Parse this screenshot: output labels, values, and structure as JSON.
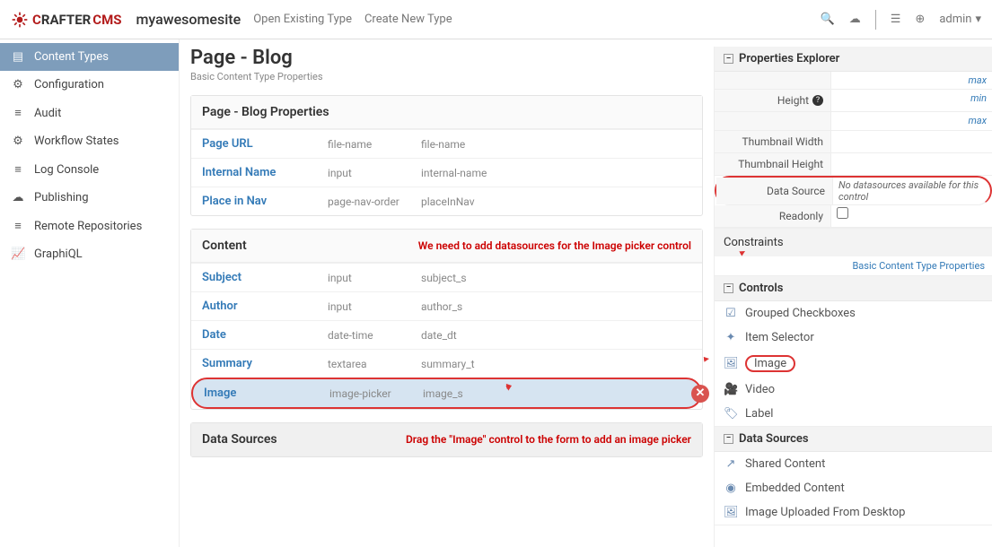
{
  "navbar": {
    "logo_text": "CRAFTER CMS",
    "site_name": "myawesomesite",
    "links": [
      "Open Existing Type",
      "Create New Type"
    ],
    "admin_label": "admin"
  },
  "sidebar": {
    "items": [
      {
        "icon": "list",
        "label": "Content Types"
      },
      {
        "icon": "gear",
        "label": "Configuration"
      },
      {
        "icon": "lines",
        "label": "Audit"
      },
      {
        "icon": "gear",
        "label": "Workflow States"
      },
      {
        "icon": "lines",
        "label": "Log Console"
      },
      {
        "icon": "cloud",
        "label": "Publishing"
      },
      {
        "icon": "lines",
        "label": "Remote Repositories"
      },
      {
        "icon": "chart",
        "label": "GraphiQL"
      }
    ]
  },
  "center": {
    "title": "Page - Blog",
    "subtitle": "Basic Content Type Properties",
    "panel1": {
      "heading": "Page - Blog Properties",
      "rows": [
        {
          "label": "Page URL",
          "control": "file-name",
          "var": "file-name"
        },
        {
          "label": "Internal Name",
          "control": "input",
          "var": "internal-name"
        },
        {
          "label": "Place in Nav",
          "control": "page-nav-order",
          "var": "placeInNav"
        }
      ]
    },
    "panel2": {
      "heading": "Content",
      "annotation": "We need to add datasources for the Image picker control",
      "rows": [
        {
          "label": "Subject",
          "control": "input",
          "var": "subject_s"
        },
        {
          "label": "Author",
          "control": "input",
          "var": "author_s"
        },
        {
          "label": "Date",
          "control": "date-time",
          "var": "date_dt"
        },
        {
          "label": "Summary",
          "control": "textarea",
          "var": "summary_t"
        },
        {
          "label": "Image",
          "control": "image-picker",
          "var": "image_s"
        }
      ]
    },
    "panel3": {
      "heading": "Data Sources",
      "annotation": "Drag the \"Image\" control to the form to add an image picker"
    }
  },
  "right": {
    "prop_explorer": {
      "heading": "Properties Explorer",
      "rows": [
        {
          "label": "",
          "hint": "max"
        },
        {
          "label": "Height",
          "hint": "min"
        },
        {
          "label": "",
          "hint": "max"
        },
        {
          "label": "Thumbnail Width"
        },
        {
          "label": "Thumbnail Height"
        },
        {
          "label": "Data Source",
          "msg": "No datasources available for this control"
        },
        {
          "label": "Readonly",
          "checkbox": true
        }
      ],
      "constraints_label": "Constraints",
      "footer_link": "Basic Content Type Properties"
    },
    "controls": {
      "heading": "Controls",
      "items": [
        {
          "icon": "☑",
          "label": "Grouped Checkboxes"
        },
        {
          "icon": "✦",
          "label": "Item Selector"
        },
        {
          "icon": "🖼",
          "label": "Image"
        },
        {
          "icon": "🎥",
          "label": "Video"
        },
        {
          "icon": "🏷",
          "label": "Label"
        }
      ]
    },
    "datasources": {
      "heading": "Data Sources",
      "items": [
        {
          "icon": "↗",
          "label": "Shared Content"
        },
        {
          "icon": "◉",
          "label": "Embedded Content"
        },
        {
          "icon": "🖼",
          "label": "Image Uploaded From Desktop"
        }
      ]
    }
  }
}
